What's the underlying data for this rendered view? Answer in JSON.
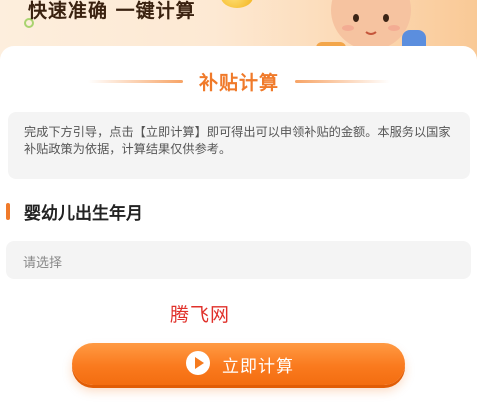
{
  "banner": {
    "slogan": "快速准确 一键计算"
  },
  "section": {
    "title": "补贴计算"
  },
  "notice": {
    "text": "完成下方引导，点击【立即计算】即可得出可以申领补贴的金额。本服务以国家补贴政策为依据，计算结果仅供参考。"
  },
  "birth_field": {
    "label": "婴幼儿出生年月",
    "placeholder": "请选择"
  },
  "watermark": {
    "text": "腾飞网"
  },
  "actions": {
    "calculate_label": "立即计算",
    "calculate_icon": "play-icon"
  },
  "colors": {
    "accent": "#f07a2a",
    "button": "#fa7a1e",
    "field_bg": "#f4f4f4",
    "watermark": "#e0302a"
  }
}
